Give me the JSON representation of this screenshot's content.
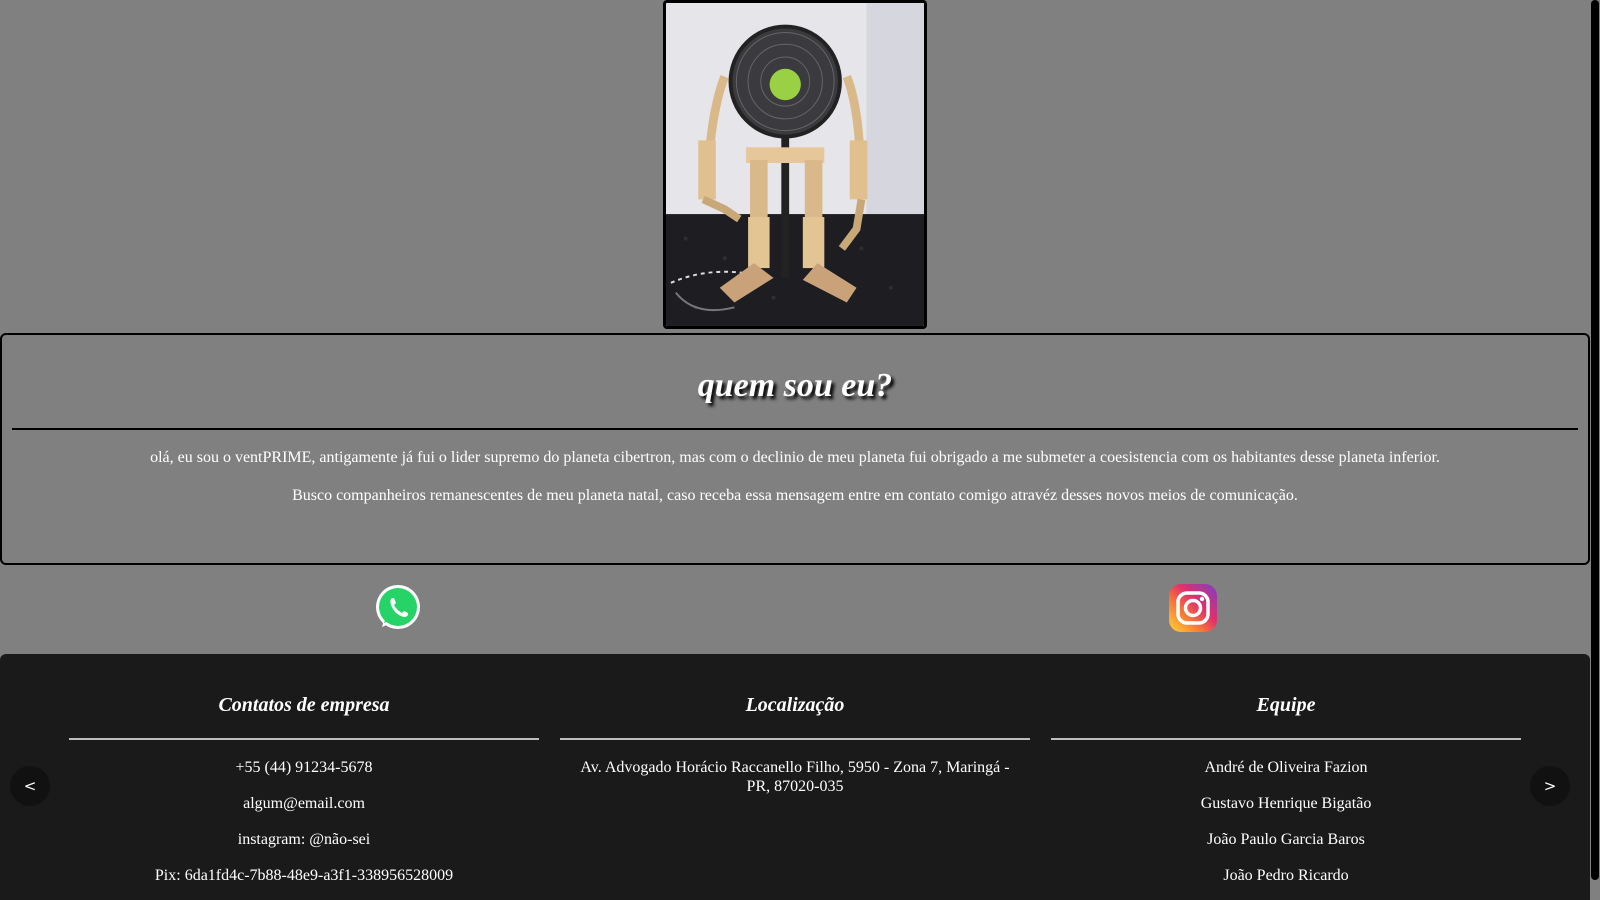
{
  "about": {
    "title": "quem sou eu?",
    "paragraph1": "olá, eu sou o ventPRIME, antigamente já fui o lider supremo do planeta cibertron, mas com o declinio de meu planeta fui obrigado a me submeter a coesistencia com os habitantes desse planeta inferior.",
    "paragraph2": "Busco companheiros remanescentes de meu planeta natal, caso receba essa mensagem entre em contato comigo atravéz desses novos meios de comunicação."
  },
  "social": {
    "whatsapp_icon": "whatsapp-icon",
    "instagram_icon": "instagram-icon"
  },
  "footer": {
    "contacts": {
      "heading": "Contatos de empresa",
      "items": [
        "+55 (44) 91234-5678",
        "algum@email.com",
        "instagram: @não-sei",
        "Pix: 6da1fd4c-7b88-48e9-a3f1-338956528009"
      ]
    },
    "location": {
      "heading": "Localização",
      "address": "Av. Advogado Horácio Raccanello Filho, 5950 - Zona 7, Maringá - PR, 87020-035"
    },
    "team": {
      "heading": "Equipe",
      "members": [
        "André de Oliveira Fazion",
        "Gustavo Henrique Bigatão",
        "João Paulo Garcia Baros",
        "João Pedro Ricardo"
      ]
    },
    "prev_label": "<",
    "next_label": ">"
  },
  "colors": {
    "page_background": "#808080",
    "footer_background": "#1a1a1a",
    "text": "#ffffff"
  }
}
